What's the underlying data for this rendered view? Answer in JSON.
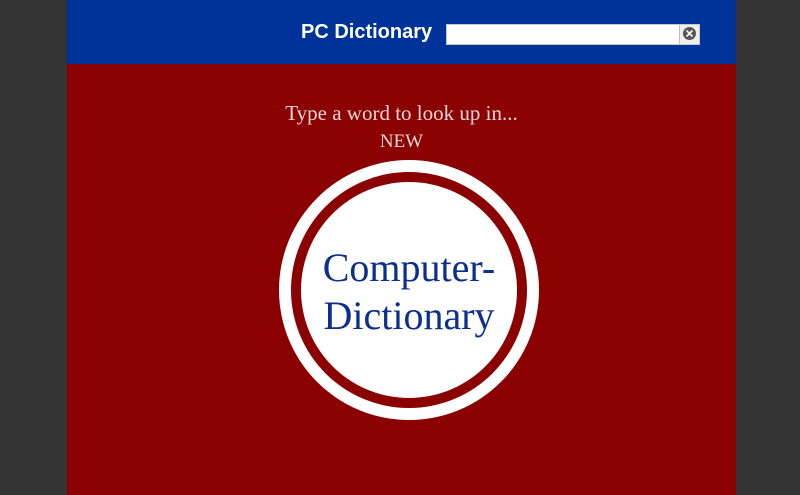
{
  "header": {
    "title": "PC Dictionary",
    "search": {
      "value": "",
      "placeholder": ""
    },
    "clear_icon": "close-circle-icon"
  },
  "main": {
    "prompt": "Type a word to look up in...",
    "badge": "NEW",
    "logo": {
      "line1": "Computer-",
      "line2": "Dictionary"
    }
  },
  "colors": {
    "header_bg": "#003399",
    "main_bg": "#8b0000",
    "logo_text": "#0b2e8f",
    "outer_bg": "#333333"
  }
}
